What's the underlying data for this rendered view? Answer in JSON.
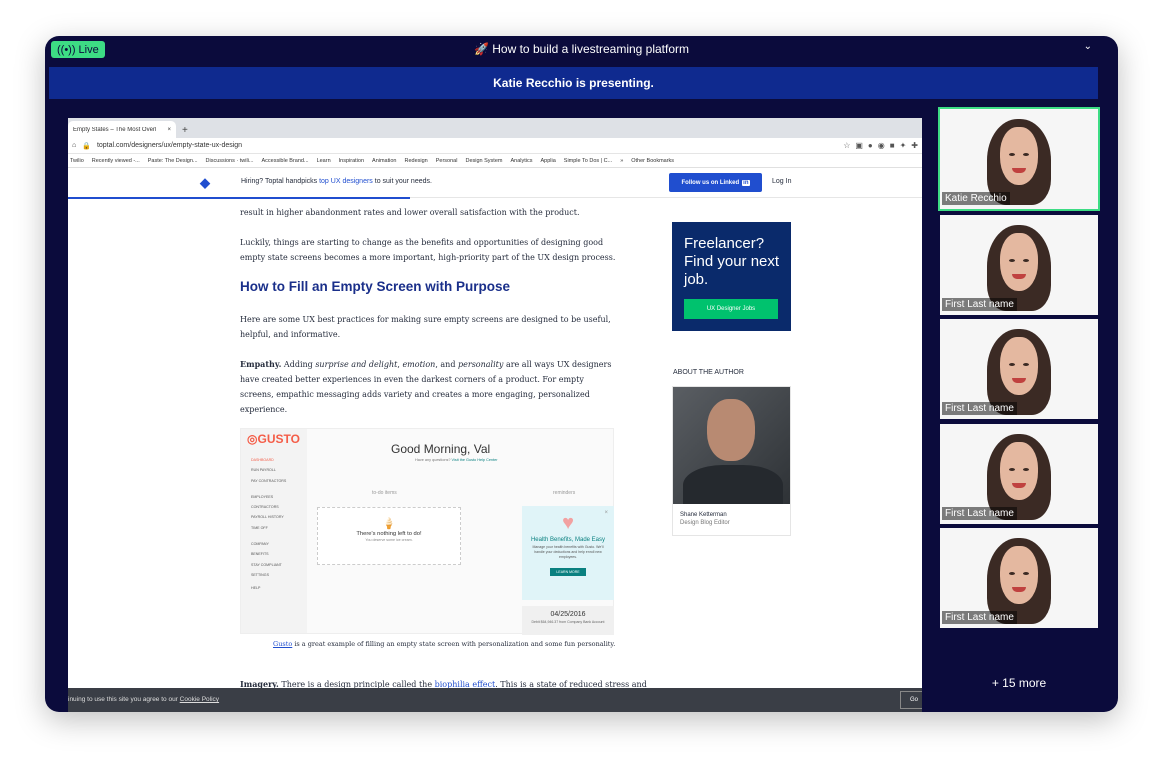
{
  "window": {
    "live_label": "Live",
    "title": "🚀 How to build a livestreaming platform",
    "presenting_banner": "Katie Recchio is presenting."
  },
  "browser": {
    "tab_title": "Empty States – The Most Overl",
    "url": "toptal.com/designers/ux/empty-state-ux-design",
    "bookmarks": [
      "Twilio",
      "Recently viewed -...",
      "Paste: The Design...",
      "Discussions · twili...",
      "Accessible Brand...",
      "Learn",
      "Inspiration",
      "Animation",
      "Redesign",
      "Personal",
      "Design System",
      "Analytics",
      "Applia",
      "Simple To Dos | C...",
      "»",
      "Other Bookmarks"
    ]
  },
  "site_header": {
    "hiring_prefix": "Hiring? Toptal handpicks",
    "hiring_link": "top UX designers",
    "hiring_suffix": "to suit your needs.",
    "follow_label": "Follow us on Linked",
    "follow_in": "in",
    "login": "Log In"
  },
  "article": {
    "p_top": "result in higher abandonment rates and lower overall satisfaction with the product.",
    "p_luckily": "Luckily, things are starting to change as the benefits and opportunities of designing good empty state screens becomes a more important, high-priority part of the UX design process.",
    "heading": "How to Fill an Empty Screen with Purpose",
    "p_here": "Here are some UX best practices for making sure empty screens are designed to be useful, helpful, and informative.",
    "empathy_bold": "Empathy.",
    "empathy_a": "Adding",
    "empathy_i1": "surprise and delight",
    "empathy_c1": ",",
    "empathy_i2": "emotion",
    "empathy_c2": ", and",
    "empathy_i3": "personality",
    "empathy_rest": "are all ways UX designers have created better experiences in even the darkest corners of a product. For empty screens, empathic messaging adds variety and creates a more engaging, personalized experience.",
    "caption_link": "Gusto",
    "caption_rest": "is a great example of filling an empty state screen with personalization and some fun personality.",
    "imagery_bold": "Imagery.",
    "imagery_text": "There is a design principle called the",
    "imagery_link": "biophilia effect",
    "imagery_rest": ". This is a state of reduced stress and"
  },
  "gusto": {
    "logo": "GUSTO",
    "menu": [
      "DASHBOARD",
      "RUN PAYROLL",
      "PAY CONTRACTORS",
      "EMPLOYEES",
      "CONTRACTORS",
      "PAYROLL HISTORY",
      "TIME OFF",
      "COMPANY",
      "BENEFITS",
      "STAY COMPLIANT",
      "SETTINGS",
      "HELP"
    ],
    "greeting": "Good Morning, Val",
    "question": "Have any questions?",
    "help_link": "Visit the Gusto Help Center",
    "todo_label": "to-do items",
    "reminders_label": "reminders",
    "todo_title": "There's nothing left to do!",
    "todo_sub": "You deserve some ice cream.",
    "reminder_title": "Health Benefits, Made Easy",
    "reminder_body": "Manage your health benefits with Gusto. We'll handle your deductions and help enroll new employees.",
    "reminder_btn": "LEARN MORE",
    "date": "04/25/2016",
    "debit": "Debit $64,946.37 from Company Bank Account"
  },
  "ad": {
    "text": "Freelancer? Find your next job.",
    "button": "UX Designer Jobs"
  },
  "author": {
    "section": "ABOUT THE AUTHOR",
    "name": "Shane Ketterman",
    "role": "Design Blog Editor"
  },
  "cookie": {
    "text": "inuing to use this site you agree to our",
    "link": "Cookie Policy",
    "button": "Go"
  },
  "participants": [
    {
      "name": "Katie Recchio",
      "active": true
    },
    {
      "name": "First Last name",
      "active": false
    },
    {
      "name": "First Last name",
      "active": false
    },
    {
      "name": "First Last name",
      "active": false
    },
    {
      "name": "First Last name",
      "active": false
    }
  ],
  "more_label": "+ 15 more",
  "colors": {
    "app_bg": "#0b0b3c",
    "live_green": "#3ddc84",
    "banner_blue": "#0f2a8f",
    "toptal_blue": "#204ecf"
  }
}
